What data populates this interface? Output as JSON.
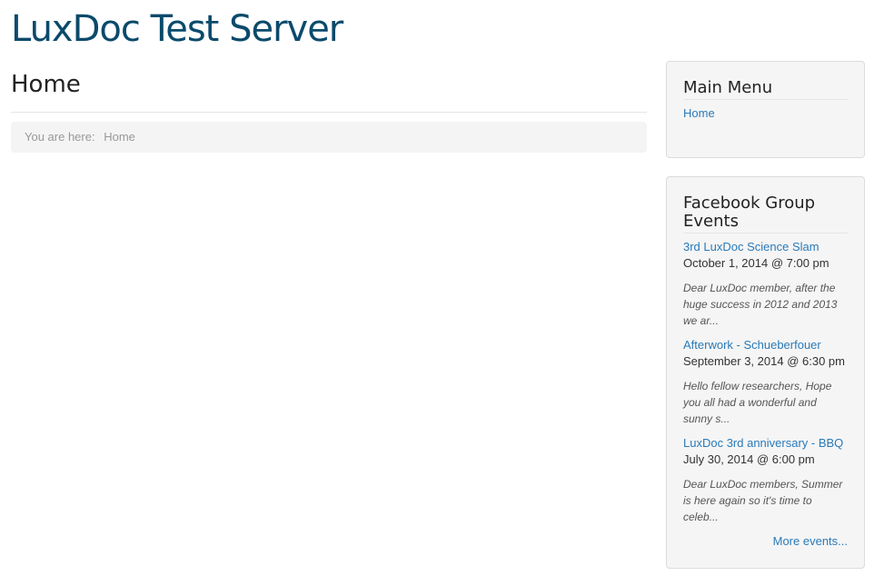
{
  "site": {
    "title": "LuxDoc Test Server"
  },
  "page": {
    "heading": "Home"
  },
  "breadcrumb": {
    "prefix": "You are here:",
    "items": [
      "Home"
    ]
  },
  "main_menu": {
    "title": "Main Menu",
    "items": [
      {
        "label": "Home"
      }
    ]
  },
  "events_module": {
    "title_line1": "Facebook Group",
    "title_line2": "Events",
    "events": [
      {
        "title": "3rd LuxDoc Science Slam",
        "date": "October 1, 2014 @ 7:00 pm",
        "description": "Dear LuxDoc member, after the huge success in 2012 and 2013 we ar..."
      },
      {
        "title": "Afterwork - Schueberfouer",
        "date": "September 3, 2014 @ 6:30 pm",
        "description": "Hello fellow researchers, Hope you all had a wonderful and sunny s..."
      },
      {
        "title": "LuxDoc 3rd anniversary - BBQ",
        "date": "July 30, 2014 @ 6:00 pm",
        "description": "Dear LuxDoc members, Summer is here again so it's time to celeb..."
      }
    ],
    "more_label": "More events..."
  },
  "colors": {
    "site_title": "#0b4a6b",
    "link": "#2a7ab8",
    "module_bg": "#f5f5f5",
    "breadcrumb_bg": "#f4f4f4"
  }
}
